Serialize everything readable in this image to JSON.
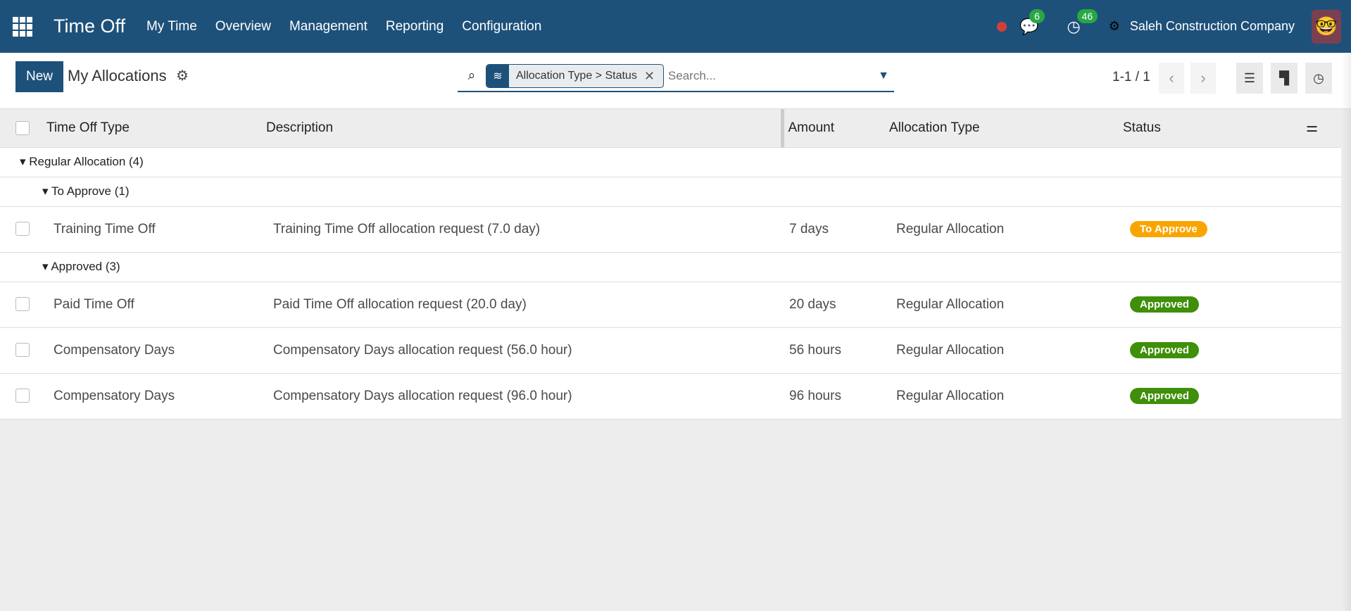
{
  "nav": {
    "app": "Time Off",
    "menu": [
      "My Time",
      "Overview",
      "Management",
      "Reporting",
      "Configuration"
    ],
    "messages_count": "6",
    "activities_count": "46",
    "company": "Saleh Construction Company"
  },
  "control": {
    "new_label": "New",
    "title": "My Allocations",
    "facet": "Allocation Type > Status",
    "search_placeholder": "Search...",
    "pager": "1-1 / 1"
  },
  "columns": [
    "Time Off Type",
    "Description",
    "Amount",
    "Allocation Type",
    "Status"
  ],
  "groups": {
    "regular": "Regular Allocation (4)",
    "to_approve": "To Approve (1)",
    "approved": "Approved (3)"
  },
  "rows": [
    {
      "type": "Training Time Off",
      "description": "Training Time Off allocation request (7.0 day)",
      "amount": "7 days",
      "alloc": "Regular Allocation",
      "status": "To Approve",
      "color": "#f9a500"
    },
    {
      "type": "Paid Time Off",
      "description": "Paid Time Off allocation request (20.0 day)",
      "amount": "20 days",
      "alloc": "Regular Allocation",
      "status": "Approved",
      "color": "#3f8f0a"
    },
    {
      "type": "Compensatory Days",
      "description": "Compensatory Days allocation request (56.0 hour)",
      "amount": "56 hours",
      "alloc": "Regular Allocation",
      "status": "Approved",
      "color": "#3f8f0a"
    },
    {
      "type": "Compensatory Days",
      "description": "Compensatory Days allocation request (96.0 hour)",
      "amount": "96 hours",
      "alloc": "Regular Allocation",
      "status": "Approved",
      "color": "#3f8f0a"
    }
  ]
}
